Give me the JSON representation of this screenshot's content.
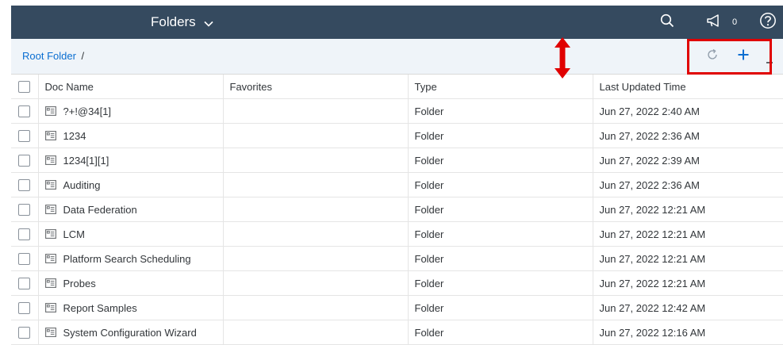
{
  "header": {
    "title": "Folders",
    "notification_count": "0"
  },
  "breadcrumb": {
    "root": "Root Folder",
    "separator": "/"
  },
  "table": {
    "columns": [
      "Doc Name",
      "Favorites",
      "Type",
      "Last Updated Time"
    ],
    "rows": [
      {
        "name": "?+!@34[1]",
        "favorites": "",
        "type": "Folder",
        "updated": "Jun 27, 2022 2:40 AM"
      },
      {
        "name": "1234",
        "favorites": "",
        "type": "Folder",
        "updated": "Jun 27, 2022 2:36 AM"
      },
      {
        "name": "1234[1][1]",
        "favorites": "",
        "type": "Folder",
        "updated": "Jun 27, 2022 2:39 AM"
      },
      {
        "name": "Auditing",
        "favorites": "",
        "type": "Folder",
        "updated": "Jun 27, 2022 2:36 AM"
      },
      {
        "name": "Data Federation",
        "favorites": "",
        "type": "Folder",
        "updated": "Jun 27, 2022 12:21 AM"
      },
      {
        "name": "LCM",
        "favorites": "",
        "type": "Folder",
        "updated": "Jun 27, 2022 12:21 AM"
      },
      {
        "name": "Platform Search Scheduling",
        "favorites": "",
        "type": "Folder",
        "updated": "Jun 27, 2022 12:21 AM"
      },
      {
        "name": "Probes",
        "favorites": "",
        "type": "Folder",
        "updated": "Jun 27, 2022 12:21 AM"
      },
      {
        "name": "Report Samples",
        "favorites": "",
        "type": "Folder",
        "updated": "Jun 27, 2022 12:42 AM"
      },
      {
        "name": "System Configuration Wizard",
        "favorites": "",
        "type": "Folder",
        "updated": "Jun 27, 2022 12:16 AM"
      }
    ]
  },
  "icons": {
    "title_dropdown": "chevron-down-icon",
    "search": "search-icon",
    "notifications": "megaphone-icon",
    "help": "help-icon",
    "refresh": "refresh-icon",
    "add": "plus-icon",
    "more": "minus-icon",
    "row_item": "folder-doc-icon",
    "annotation": "double-arrow-icon"
  },
  "colors": {
    "header_bg": "#354a5f",
    "breadcrumb_bg": "#eff4f9",
    "link": "#0a6ed1",
    "highlight": "#e00000",
    "toolbar_icon": "#0a6ed1"
  }
}
